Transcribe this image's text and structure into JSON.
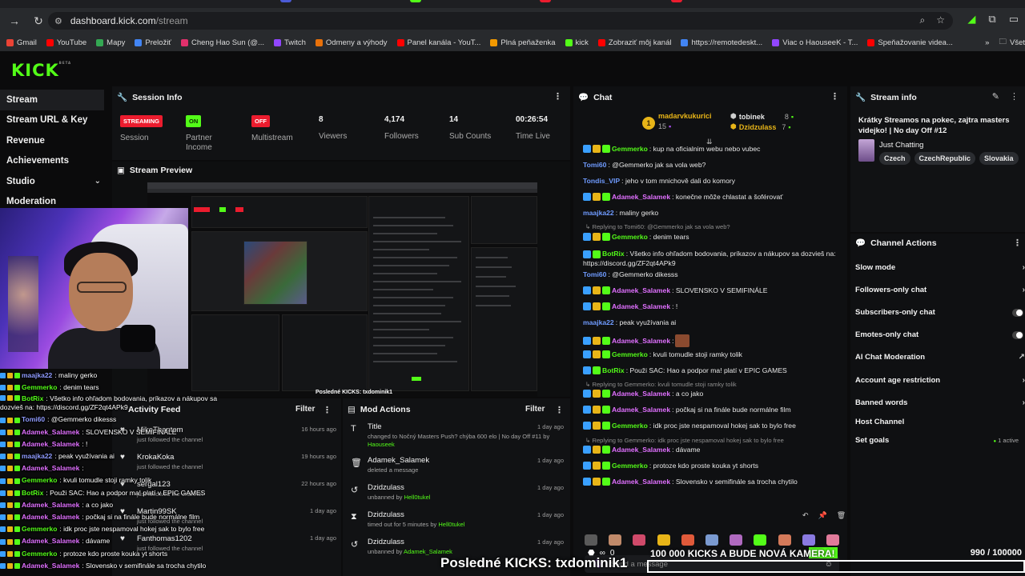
{
  "browser": {
    "url_host": "dashboard.kick.com",
    "url_path": "/stream",
    "bookmarks": [
      {
        "label": "Gmail",
        "color": "#ea4335"
      },
      {
        "label": "YouTube",
        "color": "#ff0000"
      },
      {
        "label": "Mapy",
        "color": "#34a853"
      },
      {
        "label": "Preložiť",
        "color": "#4285f4"
      },
      {
        "label": "Cheng Hao Sun (@...",
        "color": "#e1306c"
      },
      {
        "label": "Twitch",
        "color": "#9146ff"
      },
      {
        "label": "Odmeny a výhody",
        "color": "#e8710a"
      },
      {
        "label": "Panel kanála - YouT...",
        "color": "#ff0000"
      },
      {
        "label": "Plná peňaženka",
        "color": "#f29900"
      },
      {
        "label": "kick",
        "color": "#53fc18"
      },
      {
        "label": "Zobraziť môj kanál",
        "color": "#ff0000"
      },
      {
        "label": "https://remotedeskt...",
        "color": "#4285f4"
      },
      {
        "label": "Viac o HaouseeK - T...",
        "color": "#9146ff"
      },
      {
        "label": "Speňažovanie videa...",
        "color": "#ff0000"
      }
    ],
    "other_bookmarks": "Všet"
  },
  "app": {
    "logo": "KICK",
    "logo_sup": "BETA"
  },
  "sidebar": {
    "items": [
      {
        "label": "Stream",
        "active": true
      },
      {
        "label": "Stream URL & Key"
      },
      {
        "label": "Revenue"
      },
      {
        "label": "Achievements"
      },
      {
        "label": "Studio",
        "chevron": true
      },
      {
        "label": "Moderation"
      }
    ]
  },
  "session": {
    "title": "Session Info",
    "stats": [
      {
        "badge": "STREAMING",
        "badge_color": "red",
        "label": "Session"
      },
      {
        "badge": "ON",
        "badge_color": "green",
        "label": "Partner Income"
      },
      {
        "badge": "OFF",
        "badge_color": "red",
        "label": "Multistream"
      },
      {
        "value": "8",
        "label": "Viewers"
      },
      {
        "value": "4,174",
        "label": "Followers"
      },
      {
        "value": "14",
        "label": "Sub Counts"
      },
      {
        "value": "00:26:54",
        "label": "Time Live"
      }
    ]
  },
  "preview": {
    "title": "Stream Preview",
    "inner_kicks": "Posledné KICKS: txdominik1"
  },
  "overlay_chat": [
    {
      "user": "maajka22",
      "color": "#8f9bff",
      "text": ": maliny gerko"
    },
    {
      "user": "Gemmerko",
      "color": "#53fc18",
      "text": ": denim tears"
    },
    {
      "user": "BotRix",
      "color": "#53fc18",
      "text": ": Všetko info ohľadom bodovania, príkazov a nákupov sa dozvieš na: https://discord.gg/ZF2qt4APk9",
      "wrap": true
    },
    {
      "user": "Tomi60",
      "color": "#8f9bff",
      "text": ": @Gemmerko dikesss"
    },
    {
      "user": "Adamek_Salamek",
      "color": "#e070ff",
      "text": ": SLOVENSKO V SEMIFINÁLE"
    },
    {
      "user": "Adamek_Salamek",
      "color": "#e070ff",
      "text": ": !"
    },
    {
      "user": "maajka22",
      "color": "#8f9bff",
      "text": ": peak využívania ai"
    },
    {
      "user": "Adamek_Salamek",
      "color": "#e070ff",
      "text": ":"
    },
    {
      "user": "Gemmerko",
      "color": "#53fc18",
      "text": ": kvuli tomudle stoji ramky tolik"
    },
    {
      "user": "BotRix",
      "color": "#53fc18",
      "text": ": Použi SAC: Hao a podpor ma! platí v EPIC GAMES"
    },
    {
      "user": "Adamek_Salamek",
      "color": "#e070ff",
      "text": ": a co jako"
    },
    {
      "user": "Adamek_Salamek",
      "color": "#e070ff",
      "text": ": počkaj si na finále bude normálne film"
    },
    {
      "user": "Gemmerko",
      "color": "#53fc18",
      "text": ": idk proc jste nespamoval hokej sak to bylo free"
    },
    {
      "user": "Adamek_Salamek",
      "color": "#e070ff",
      "text": ": dávame"
    },
    {
      "user": "Gemmerko",
      "color": "#53fc18",
      "text": ": protoze kdo proste kouka yt shorts"
    },
    {
      "user": "Adamek_Salamek",
      "color": "#e070ff",
      "text": ": Slovensko v semifinále sa trocha chytilo"
    }
  ],
  "activity": {
    "title": "Activity Feed",
    "filter": "Filter",
    "rows": [
      {
        "name": "MikeThantom",
        "sub": "just followed the channel",
        "time": "16 hours ago"
      },
      {
        "name": "KrokaKoka",
        "sub": "just followed the channel",
        "time": "19 hours ago"
      },
      {
        "name": "sergal123",
        "sub": "just followed the channel",
        "time": "22 hours ago"
      },
      {
        "name": "Martin99SK",
        "sub": "just followed the channel",
        "time": "1 day ago"
      },
      {
        "name": "Fanthomas1202",
        "sub": "just followed the channel",
        "time": "1 day ago"
      }
    ]
  },
  "mod": {
    "title": "Mod Actions",
    "filter": "Filter",
    "rows": [
      {
        "icon": "T",
        "name": "Title",
        "sub": "changed to Nočný Masters Push? chýba 600 elo | No day Off #11",
        "by_pre": "by ",
        "by": "Haouseek",
        "time": "1 day ago"
      },
      {
        "icon": "🗑",
        "name": "Adamek_Salamek",
        "sub": "deleted a message",
        "time": "1 day ago"
      },
      {
        "icon": "↺",
        "name": "Dzidzulass",
        "sub": "unbanned by ",
        "by": "Hell0tukel",
        "time": "1 day ago"
      },
      {
        "icon": "⧗",
        "name": "Dzidzulass",
        "sub": "timed out for 5 minutes by ",
        "by": "Hell0tukel",
        "time": "1 day ago"
      },
      {
        "icon": "↺",
        "name": "Dzidzulass",
        "sub": "unbanned by ",
        "by": "Adamek_Salamek",
        "time": "1 day ago"
      }
    ]
  },
  "chat": {
    "title": "Chat",
    "pinned": [
      {
        "user": "madarvkukurici",
        "count": "15"
      },
      {
        "user": "tobinek",
        "count": "8"
      },
      {
        "user": "Dzidzulass",
        "count": "7"
      }
    ],
    "lines": [
      {
        "user": "Gemmerko",
        "color": "#53fc18",
        "text": ": kup na oficialnim webu nebo vubec",
        "badges": 3
      },
      {
        "user": "Tomi60",
        "color": "#6f9bff",
        "text": ": @Gemmerko jak sa vola web?",
        "badges": 0
      },
      {
        "user": "Tondis_VIP",
        "color": "#6f9bff",
        "text": ": jeho v tom mnichově dali do komory",
        "badges": 0
      },
      {
        "user": "Adamek_Salamek",
        "color": "#e070ff",
        "text": ": konečne môže chlastat a šoférovať",
        "badges": 3
      },
      {
        "user": "maajka22",
        "color": "#6f9bff",
        "text": ": maliny gerko",
        "badges": 0
      },
      {
        "reply": "Replying to Tomi60: @Gemmerko jak sa vola web?"
      },
      {
        "user": "Gemmerko",
        "color": "#53fc18",
        "text": ": denim tears",
        "badges": 3
      },
      {
        "user": "BotRix",
        "color": "#53fc18",
        "text": ": Všetko info ohľadom bodovania, príkazov a nákupov sa dozvieš na: https://discord.gg/ZF2qt4APk9",
        "badges": 2,
        "wrap": true
      },
      {
        "user": "Tomi60",
        "color": "#6f9bff",
        "text": ": @Gemmerko dikesss",
        "badges": 0
      },
      {
        "user": "Adamek_Salamek",
        "color": "#e070ff",
        "text": ": SLOVENSKO V SEMIFINÁLE",
        "badges": 3
      },
      {
        "user": "Adamek_Salamek",
        "color": "#e070ff",
        "text": ": !",
        "badges": 3
      },
      {
        "user": "maajka22",
        "color": "#6f9bff",
        "text": ": peak využívania ai",
        "badges": 0
      },
      {
        "user": "Adamek_Salamek",
        "color": "#e070ff",
        "text": ":",
        "badges": 3,
        "emote": true
      },
      {
        "user": "Gemmerko",
        "color": "#53fc18",
        "text": ": kvuli tomudle stoji ramky tolik",
        "badges": 3
      },
      {
        "user": "BotRix",
        "color": "#53fc18",
        "text": ": Použi SAC: Hao a podpor ma! platí v EPIC GAMES",
        "badges": 2
      },
      {
        "reply": "Replying to Gemmerko: kvuli tomudle stoji ramky tolik"
      },
      {
        "user": "Adamek_Salamek",
        "color": "#e070ff",
        "text": ": a co jako",
        "badges": 3
      },
      {
        "user": "Adamek_Salamek",
        "color": "#e070ff",
        "text": ": počkaj si na finále bude normálne film",
        "badges": 3
      },
      {
        "user": "Gemmerko",
        "color": "#53fc18",
        "text": ": idk proc jste nespamoval hokej sak to bylo free",
        "badges": 3
      },
      {
        "reply": "Replying to Gemmerko: idk proc jste nespamoval hokej sak to bylo free"
      },
      {
        "user": "Adamek_Salamek",
        "color": "#e070ff",
        "text": ": dávame",
        "badges": 3
      },
      {
        "user": "Gemmerko",
        "color": "#53fc18",
        "text": ": protoze kdo proste kouka yt shorts",
        "badges": 3
      },
      {
        "user": "Adamek_Salamek",
        "color": "#e070ff",
        "text": ": Slovensko v semifinále sa trocha chytilo",
        "badges": 3
      }
    ],
    "input_placeholder": "Send a message"
  },
  "stream_info": {
    "title": "Stream info",
    "stream_title": "Krátky Streamos na pokec, zajtra masters videjko! | No day Off #12",
    "category": "Just Chatting",
    "tags": [
      "Czech",
      "CzechRepublic",
      "Slovakia"
    ]
  },
  "channel_actions": {
    "title": "Channel Actions",
    "rows": [
      {
        "label": "Slow mode",
        "kind": "arrow"
      },
      {
        "label": "Followers-only chat",
        "kind": "arrow"
      },
      {
        "label": "Subscribers-only chat",
        "kind": "toggle"
      },
      {
        "label": "Emotes-only chat",
        "kind": "toggle"
      },
      {
        "label": "AI Chat Moderation",
        "kind": "link"
      },
      {
        "label": "Account age restriction",
        "kind": "arrow"
      },
      {
        "label": "Banned words",
        "kind": "arrow"
      },
      {
        "label": "Host Channel",
        "kind": "none"
      },
      {
        "label": "Set goals",
        "kind": "active",
        "extra": "1 active"
      }
    ]
  },
  "overlay_bottom": {
    "goal_text": "100 000 KICKS A BUDE NOVÁ KAMERA!",
    "goal_current": "990",
    "goal_total": "/ 100000",
    "goal_zero": "0",
    "kicks_banner": "Posledné KICKS: txdominik1"
  }
}
